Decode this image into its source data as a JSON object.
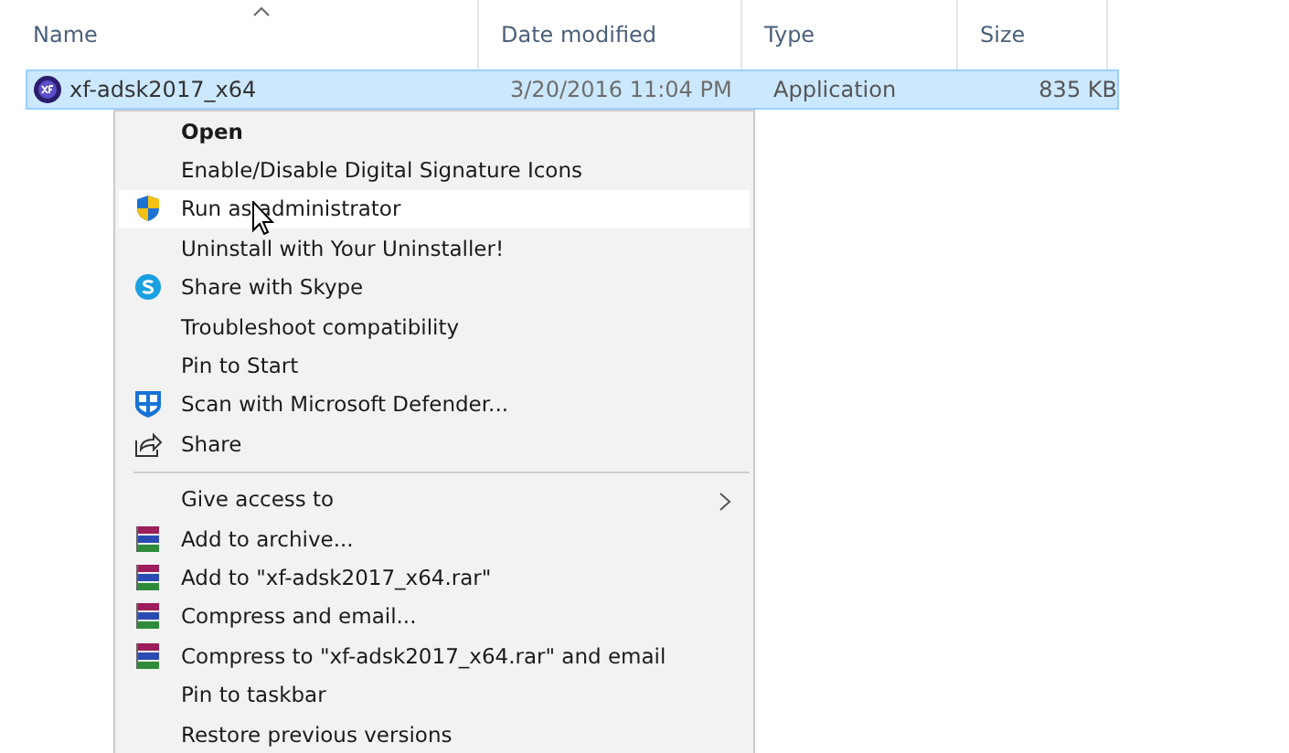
{
  "columns": [
    {
      "label": "Name",
      "sorted": true
    },
    {
      "label": "Date modified",
      "sorted": false
    },
    {
      "label": "Type",
      "sorted": false
    },
    {
      "label": "Size",
      "sorted": false
    }
  ],
  "file": {
    "name": "xf-adsk2017_x64",
    "date": "3/20/2016 11:04 PM",
    "type": "Application",
    "size": "835 KB",
    "selected": true
  },
  "context_menu": {
    "groups": [
      [
        {
          "label": "Open",
          "default": true,
          "selected": false
        },
        {
          "label": "Enable/Disable Digital Signature Icons",
          "default": false,
          "selected": false
        },
        {
          "label": "Run as administrator",
          "kind": "shield",
          "default": false,
          "selected": true
        },
        {
          "label": "Uninstall with Your Uninstaller!",
          "default": false,
          "selected": false
        },
        {
          "label": "Share with Skype",
          "kind": "skype",
          "default": false,
          "selected": false
        },
        {
          "label": "Troubleshoot compatibility",
          "default": false,
          "selected": false
        },
        {
          "label": "Pin to Start",
          "default": false,
          "selected": false
        },
        {
          "label": "Scan with Microsoft Defender...",
          "kind": "defender",
          "default": false,
          "selected": false
        },
        {
          "label": "Share",
          "kind": "share",
          "default": false,
          "selected": false
        }
      ],
      [
        {
          "label": "Give access to",
          "submenu": true,
          "default": false,
          "selected": false
        },
        {
          "label": "Add to archive...",
          "kind": "archive",
          "default": false,
          "selected": false
        },
        {
          "label": "Add to \"xf-adsk2017_x64.rar\"",
          "kind": "archive",
          "default": false,
          "selected": false
        },
        {
          "label": "Compress and email...",
          "kind": "archive",
          "default": false,
          "selected": false
        },
        {
          "label": "Compress to \"xf-adsk2017_x64.rar\" and email",
          "kind": "archive",
          "default": false,
          "selected": false
        },
        {
          "label": "Pin to taskbar",
          "default": false,
          "selected": false
        },
        {
          "label": "Restore previous versions",
          "default": false,
          "selected": false
        }
      ]
    ]
  }
}
